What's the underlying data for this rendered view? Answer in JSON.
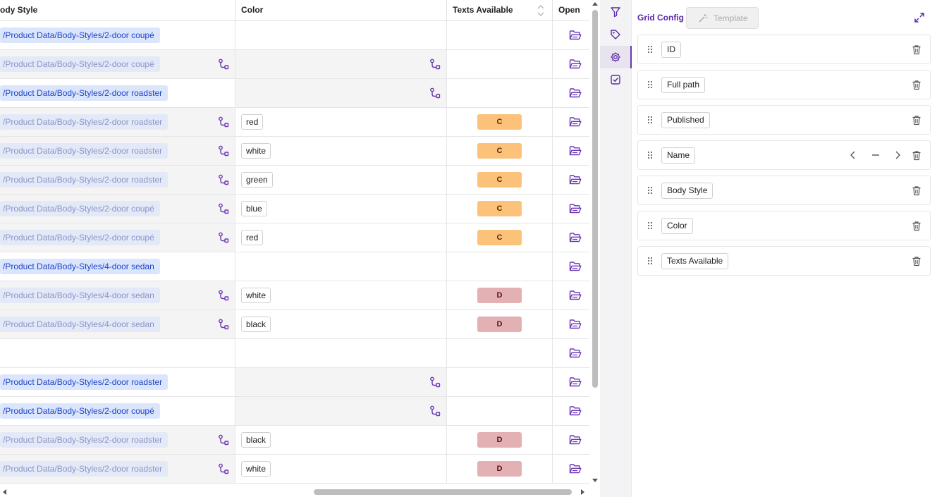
{
  "grid": {
    "columns": {
      "body_style": "ody Style",
      "color": "Color",
      "texts_available": "Texts Available",
      "open": "Open"
    },
    "rows": [
      {
        "body": "/Product Data/Body-Styles/2-door coupé",
        "body_inherited": false,
        "color": "",
        "color_inherited": false,
        "texts": ""
      },
      {
        "body": "/Product Data/Body-Styles/2-door coupé",
        "body_inherited": true,
        "color": "",
        "color_inherited": true,
        "texts": ""
      },
      {
        "body": "/Product Data/Body-Styles/2-door roadster",
        "body_inherited": false,
        "color": "",
        "color_inherited": true,
        "texts": ""
      },
      {
        "body": "/Product Data/Body-Styles/2-door roadster",
        "body_inherited": true,
        "color": "red",
        "color_inherited": false,
        "texts": "C"
      },
      {
        "body": "/Product Data/Body-Styles/2-door roadster",
        "body_inherited": true,
        "color": "white",
        "color_inherited": false,
        "texts": "C"
      },
      {
        "body": "/Product Data/Body-Styles/2-door roadster",
        "body_inherited": true,
        "color": "green",
        "color_inherited": false,
        "texts": "C"
      },
      {
        "body": "/Product Data/Body-Styles/2-door coupé",
        "body_inherited": true,
        "color": "blue",
        "color_inherited": false,
        "texts": "C"
      },
      {
        "body": "/Product Data/Body-Styles/2-door coupé",
        "body_inherited": true,
        "color": "red",
        "color_inherited": false,
        "texts": "C"
      },
      {
        "body": "/Product Data/Body-Styles/4-door sedan",
        "body_inherited": false,
        "color": "",
        "color_inherited": false,
        "texts": ""
      },
      {
        "body": "/Product Data/Body-Styles/4-door sedan",
        "body_inherited": true,
        "color": "white",
        "color_inherited": false,
        "texts": "D"
      },
      {
        "body": "/Product Data/Body-Styles/4-door sedan",
        "body_inherited": true,
        "color": "black",
        "color_inherited": false,
        "texts": "D"
      },
      {
        "body": "",
        "body_inherited": false,
        "color": "",
        "color_inherited": false,
        "texts": ""
      },
      {
        "body": "/Product Data/Body-Styles/2-door roadster",
        "body_inherited": false,
        "color": "",
        "color_inherited": true,
        "texts": ""
      },
      {
        "body": "/Product Data/Body-Styles/2-door coupé",
        "body_inherited": false,
        "color": "",
        "color_inherited": true,
        "texts": ""
      },
      {
        "body": "/Product Data/Body-Styles/2-door roadster",
        "body_inherited": true,
        "color": "black",
        "color_inherited": false,
        "texts": "D"
      },
      {
        "body": "/Product Data/Body-Styles/2-door roadster",
        "body_inherited": true,
        "color": "white",
        "color_inherited": false,
        "texts": "D"
      }
    ],
    "icons": {
      "inherited": "inheritance-icon",
      "open": "folder-open-icon"
    }
  },
  "toolbar": {
    "buttons": [
      {
        "name": "filter-icon",
        "active": false
      },
      {
        "name": "tag-icon",
        "active": false
      },
      {
        "name": "gear-icon",
        "active": true
      },
      {
        "name": "checkbox-icon",
        "active": false
      }
    ]
  },
  "config": {
    "title": "Grid Config",
    "template_label": "Template",
    "fields": [
      {
        "label": "ID",
        "controls": false
      },
      {
        "label": "Full path",
        "controls": false
      },
      {
        "label": "Published",
        "controls": false
      },
      {
        "label": "Name",
        "controls": true
      },
      {
        "label": "Body Style",
        "controls": false
      },
      {
        "label": "Color",
        "controls": false
      },
      {
        "label": "Texts Available",
        "controls": false
      }
    ]
  },
  "colors": {
    "accent": "#6b35b5",
    "path_tag_bg": "#dbe6fd",
    "path_tag_text": "#1d44c8",
    "badge_c": "#fcc27a",
    "badge_d": "#e3b1b3"
  }
}
